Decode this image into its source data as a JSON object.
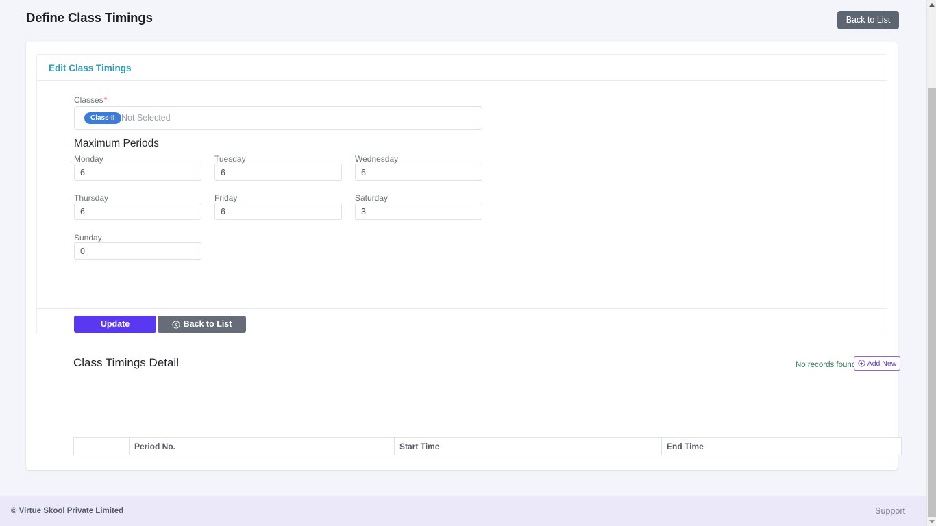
{
  "page": {
    "title": "Define Class Timings",
    "back_to_list_top": "Back to List"
  },
  "edit_card": {
    "title": "Edit Class Timings",
    "classes_field": {
      "label": "Classes",
      "required_marker": "*",
      "selected_tag": "Class-II",
      "placeholder": "Not Selected"
    },
    "max_periods_heading": "Maximum Periods",
    "days": [
      {
        "label": "Monday",
        "value": "6"
      },
      {
        "label": "Tuesday",
        "value": "6"
      },
      {
        "label": "Wednesday",
        "value": "6"
      },
      {
        "label": "Thursday",
        "value": "6"
      },
      {
        "label": "Friday",
        "value": "6"
      },
      {
        "label": "Saturday",
        "value": "3"
      },
      {
        "label": "Sunday",
        "value": "0"
      }
    ],
    "buttons": {
      "update": "Update",
      "back_to_list": "Back to List",
      "back_icon": "arrow-circle-left-icon"
    }
  },
  "detail": {
    "title": "Class Timings Detail",
    "no_records_text": "No records found.",
    "add_new_label": "Add New",
    "add_new_icon": "plus-circle-icon",
    "table": {
      "columns": [
        "",
        "Period No.",
        "Start Time",
        "End Time"
      ],
      "rows": []
    }
  },
  "footer": {
    "copyright": "© Virtue Skool Private Limited",
    "support": "Support"
  },
  "colors": {
    "page_background": "#f4f5fa",
    "primary_button": "#5a37f0",
    "secondary_button": "#5d6573",
    "link_heading": "#2e9bc0",
    "tag_blue": "#3c7dd9",
    "success_text": "#2f7c52",
    "accent_purple": "#6f42c1",
    "footer_background": "#ebe8fa",
    "required_star": "#ee6b63"
  }
}
